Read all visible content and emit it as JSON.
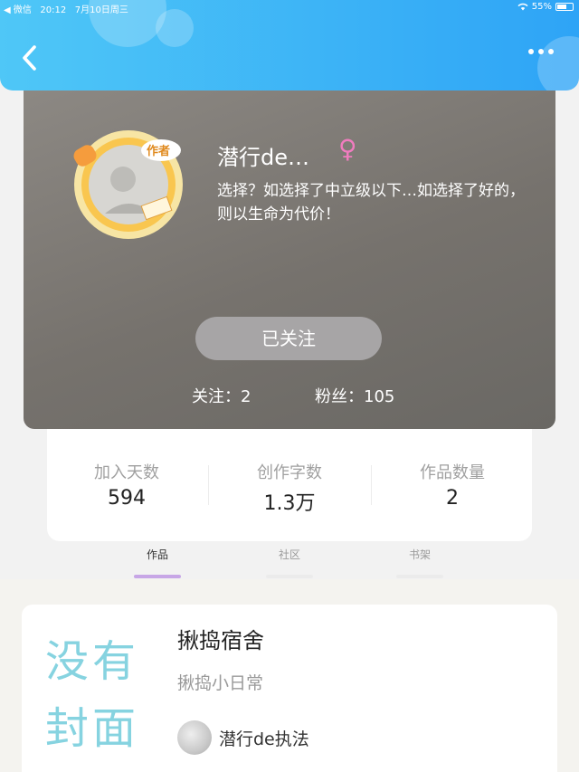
{
  "status_bar": {
    "carrier": "◀ 微信",
    "time": "20:12",
    "date": "7月10日周三",
    "battery": "55%",
    "battery_level": 0.55
  },
  "profile": {
    "name": "潜行de…",
    "gender_symbol": "♀",
    "bio": "选择？如选择了中立级以下…如选择了好的，则以生命为代价！",
    "avatar_badge": "作者",
    "follow_button": "已关注",
    "following": "关注：2",
    "followers": "粉丝：105"
  },
  "stats": [
    {
      "label": "加入天数",
      "value": "594"
    },
    {
      "label": "创作字数",
      "value": "1.3万"
    },
    {
      "label": "作品数量",
      "value": "2"
    }
  ],
  "tabs": [
    {
      "label": "作品",
      "active": true
    },
    {
      "label": "社区",
      "active": false
    },
    {
      "label": "书架",
      "active": false
    }
  ],
  "work": {
    "cover_text": "没有封面",
    "title": "揪捣宿舍",
    "subtitle": "揪捣小日常",
    "author": "潜行de执法"
  },
  "colors": {
    "header_start": "#4fc7f7",
    "header_end": "#2ea4f6",
    "gender": "#f07cbf",
    "active_tab": "#c7a6e6",
    "cover_text": "#86d3e0"
  },
  "icons": {
    "back": "chevron-left-icon",
    "more": "more-dots-icon",
    "wifi": "wifi-icon",
    "battery": "battery-icon"
  }
}
